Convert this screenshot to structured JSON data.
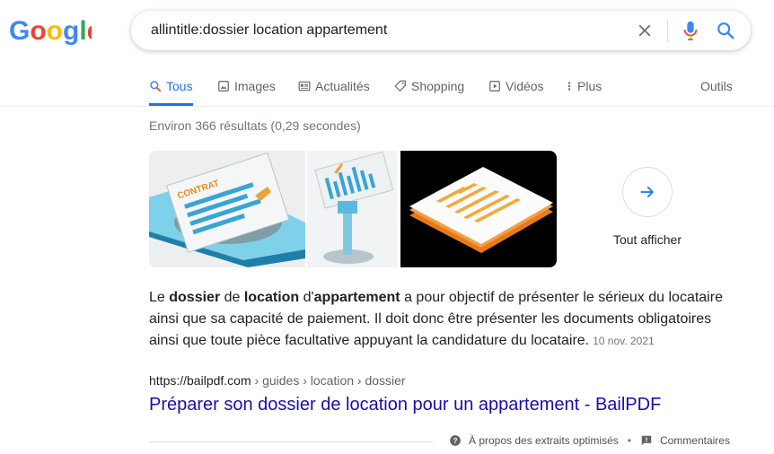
{
  "logo": {
    "text": "Google",
    "letters": [
      "G",
      "o",
      "o",
      "g",
      "l",
      "e"
    ]
  },
  "search": {
    "query": "allintitle:dossier location appartement"
  },
  "tabs": [
    {
      "label": "Tous",
      "icon": "search-icon",
      "active": true
    },
    {
      "label": "Images",
      "icon": "image-icon",
      "active": false
    },
    {
      "label": "Actualités",
      "icon": "news-icon",
      "active": false
    },
    {
      "label": "Shopping",
      "icon": "tag-icon",
      "active": false
    },
    {
      "label": "Vidéos",
      "icon": "play-icon",
      "active": false
    },
    {
      "label": "Plus",
      "icon": "more-vert-icon",
      "active": false
    }
  ],
  "tools": {
    "label": "Outils"
  },
  "stats": "Environ 366 résultats (0,29 secondes)",
  "images": {
    "thumb1_label": "CONTRAT",
    "show_all_label": "Tout afficher"
  },
  "snippet": {
    "part1": "Le ",
    "b1": "dossier",
    "part2": " de ",
    "b2": "location",
    "part3": " d'",
    "b3": "appartement",
    "part4": " a pour objectif de présenter le sérieux du locataire ainsi que sa capacité de paiement. Il doit donc être présenter les documents obligatoires ainsi que toute pièce facultative appuyant la candidature du locataire.",
    "date": "10 nov. 2021"
  },
  "result": {
    "domain": "https://bailpdf.com",
    "path": " › guides › location › dossier",
    "title": "Préparer son dossier de location pour un appartement - BailPDF"
  },
  "footer": {
    "about": "À propos des extraits optimisés",
    "separator": "•",
    "feedback": "Commentaires"
  },
  "colors": {
    "link": "#1a0dab",
    "active_tab": "#1a73e8",
    "blue": "#4285F4",
    "red": "#EA4335",
    "yellow": "#FBBC05",
    "green": "#34A853"
  }
}
